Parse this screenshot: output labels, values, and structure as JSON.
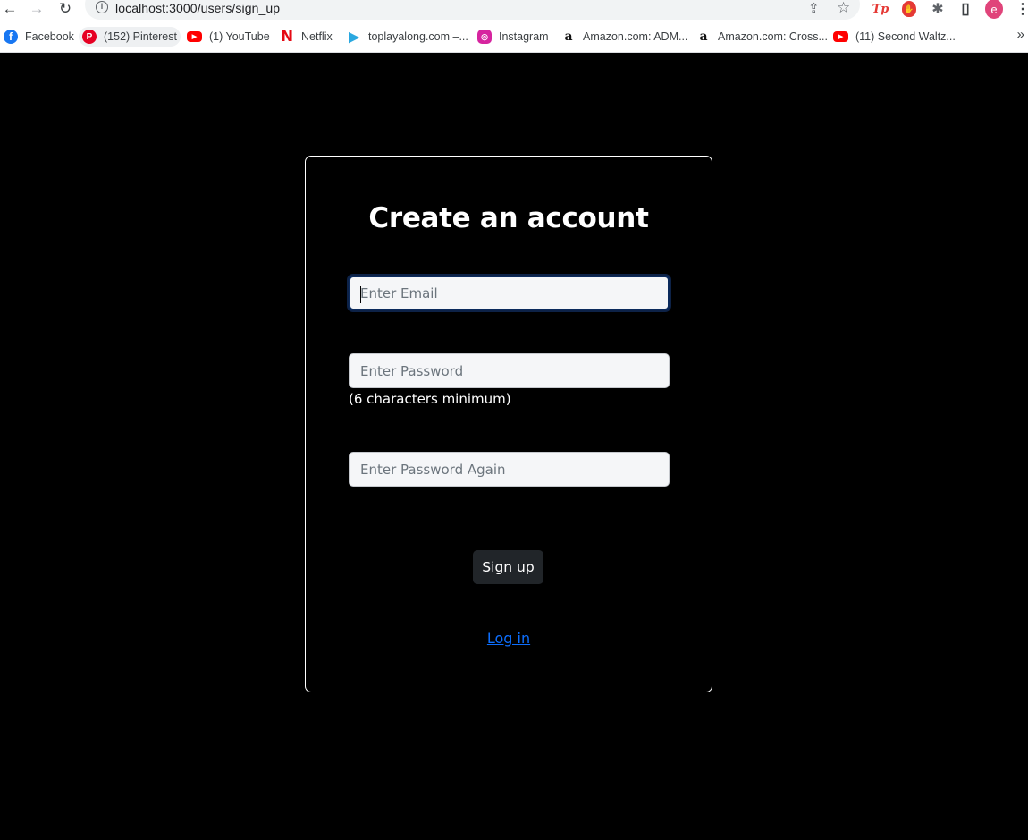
{
  "browser": {
    "url": "localhost:3000/users/sign_up",
    "back_icon": "←",
    "forward_icon": "→",
    "reload_icon": "↻",
    "info_icon": "i",
    "share_icon": "⇪",
    "star_icon": "☆",
    "tp_ext": "Tp",
    "puzzle_icon": "✱",
    "sidepanel_icon": "▯",
    "avatar_letter": "e",
    "menu_icon": "⋮"
  },
  "bookmarks": [
    {
      "label": "Facebook",
      "glyph": "f"
    },
    {
      "label": "(152) Pinterest",
      "glyph": "P"
    },
    {
      "label": "(1) YouTube",
      "glyph": "▶"
    },
    {
      "label": "Netflix",
      "glyph": "N"
    },
    {
      "label": "toplayalong.com –...",
      "glyph": "▶"
    },
    {
      "label": "Instagram",
      "glyph": "◎"
    },
    {
      "label": "Amazon.com: ADM...",
      "glyph": "a"
    },
    {
      "label": "Amazon.com: Cross...",
      "glyph": "a"
    },
    {
      "label": "(11) Second Waltz...",
      "glyph": "▶"
    }
  ],
  "bookmarks_more": "»",
  "form": {
    "title": "Create an account",
    "email_placeholder": "Enter Email",
    "password_placeholder": "Enter Password",
    "password_hint": "(6 characters minimum)",
    "password_confirm_placeholder": "Enter Password Again",
    "submit_label": "Sign up",
    "login_link": "Log in"
  },
  "colors": {
    "page_bg": "#000000",
    "button_bg": "#212529",
    "link": "#0d6efd",
    "focus_ring": "#0b2a5c"
  }
}
